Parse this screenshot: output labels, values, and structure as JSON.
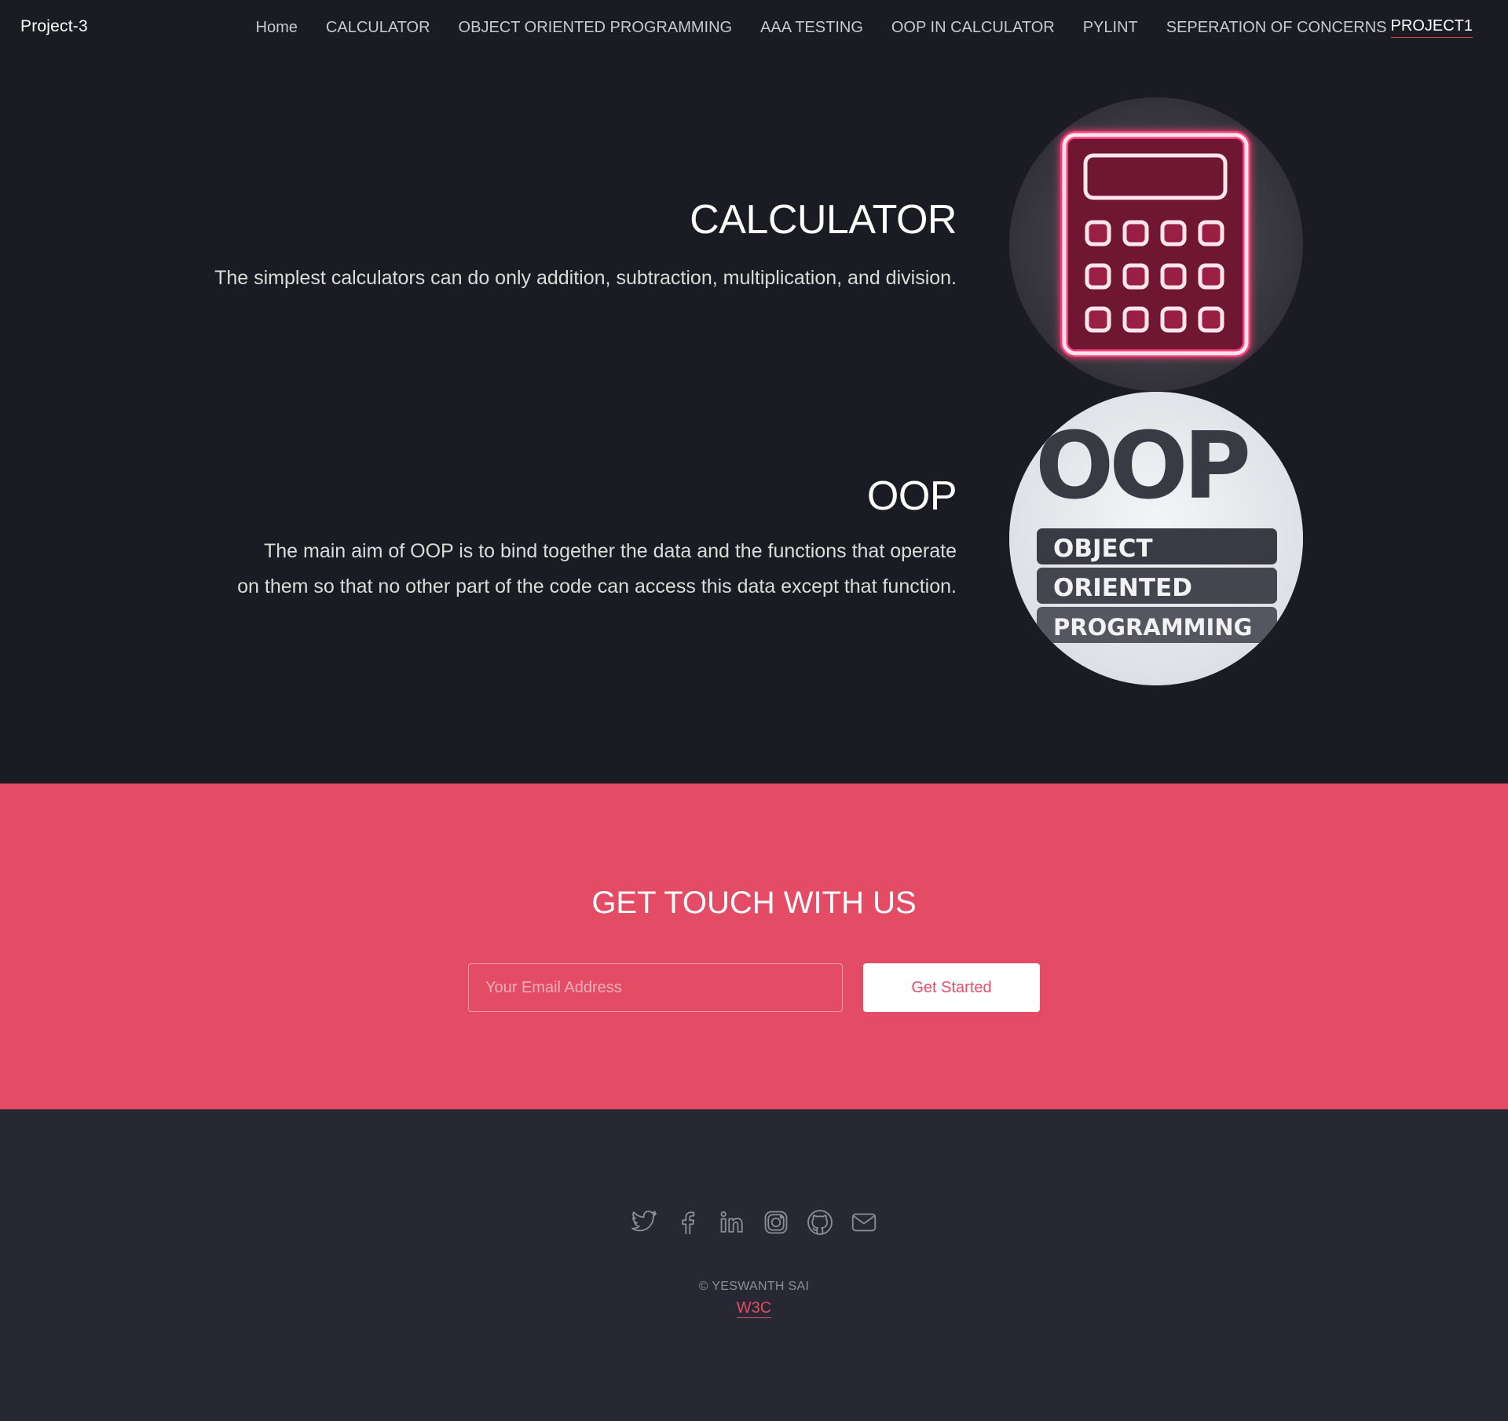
{
  "nav": {
    "brand": "Project-3",
    "links": [
      {
        "label": "Home"
      },
      {
        "label": "CALCULATOR"
      },
      {
        "label": "OBJECT ORIENTED PROGRAMMING"
      },
      {
        "label": "AAA TESTING"
      },
      {
        "label": "OOP IN CALCULATOR"
      },
      {
        "label": "PYLINT"
      },
      {
        "label": "SEPERATION OF CONCERNS"
      },
      {
        "label": "PROJECT1"
      }
    ]
  },
  "features": [
    {
      "title": "CALCULATOR",
      "description_lines": [
        "The simplest calculators can do only addition, subtraction, multiplication, and division."
      ],
      "icon": "neon-calculator-icon"
    },
    {
      "title": "OOP",
      "description_lines": [
        "The main aim of OOP is to bind together the data and the functions that operate",
        "on them so that no other part of the code can access this data except that function."
      ],
      "image_text": {
        "big": "OOP",
        "rows": [
          "OBJECT",
          "ORIENTED",
          "PROGRAMMING"
        ]
      }
    }
  ],
  "cta": {
    "title": "GET TOUCH WITH US",
    "email_placeholder": "Your Email Address",
    "button_label": "Get Started"
  },
  "footer": {
    "social_icons": [
      "twitter-icon",
      "facebook-icon",
      "linkedin-icon",
      "instagram-icon",
      "github-icon",
      "envelope-icon"
    ],
    "copyright": "© YESWANTH SAI",
    "link_label": "W3C"
  },
  "colors": {
    "background": "#1b1c23",
    "accent": "#e44c65",
    "footer_background": "#272833",
    "text_muted": "#c9c9cf"
  }
}
